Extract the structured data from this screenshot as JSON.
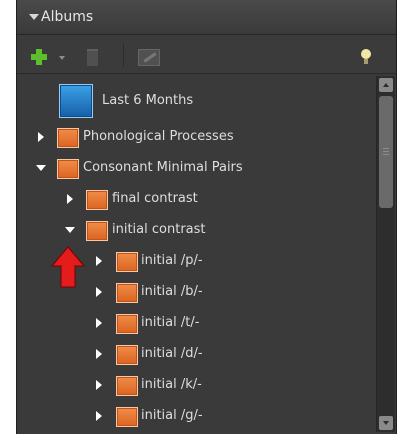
{
  "header": {
    "title": "Albums",
    "expand_icon": "triangle-down-icon"
  },
  "toolbar": {
    "add_icon": "plus-icon",
    "add_menu_icon": "chevron-down-icon",
    "delete_icon": "trash-icon",
    "edit_icon": "edit-icon",
    "tip_icon": "lightbulb-icon"
  },
  "tree": {
    "smart_album": {
      "label": "Last 6 Months",
      "icon": "smart-album-icon"
    },
    "items": [
      {
        "label": "Phonological Processes",
        "expanded": false
      },
      {
        "label": "Consonant Minimal Pairs",
        "expanded": true
      },
      {
        "label": "final contrast",
        "expanded": false
      },
      {
        "label": "initial contrast",
        "expanded": true
      },
      {
        "label": "initial /p/-",
        "expanded": false
      },
      {
        "label": "initial /b/-",
        "expanded": false
      },
      {
        "label": "initial /t/-",
        "expanded": false
      },
      {
        "label": "initial /d/-",
        "expanded": false
      },
      {
        "label": "initial /k/-",
        "expanded": false
      },
      {
        "label": "initial /g/-",
        "expanded": false
      }
    ]
  },
  "annotation": {
    "icon": "red-arrow-up-icon",
    "color": "#e51c1c"
  },
  "colors": {
    "panel": "#3a3a3a",
    "folder": "#e8742e",
    "smart_album": "#2a7fd0",
    "text": "#dedede"
  }
}
